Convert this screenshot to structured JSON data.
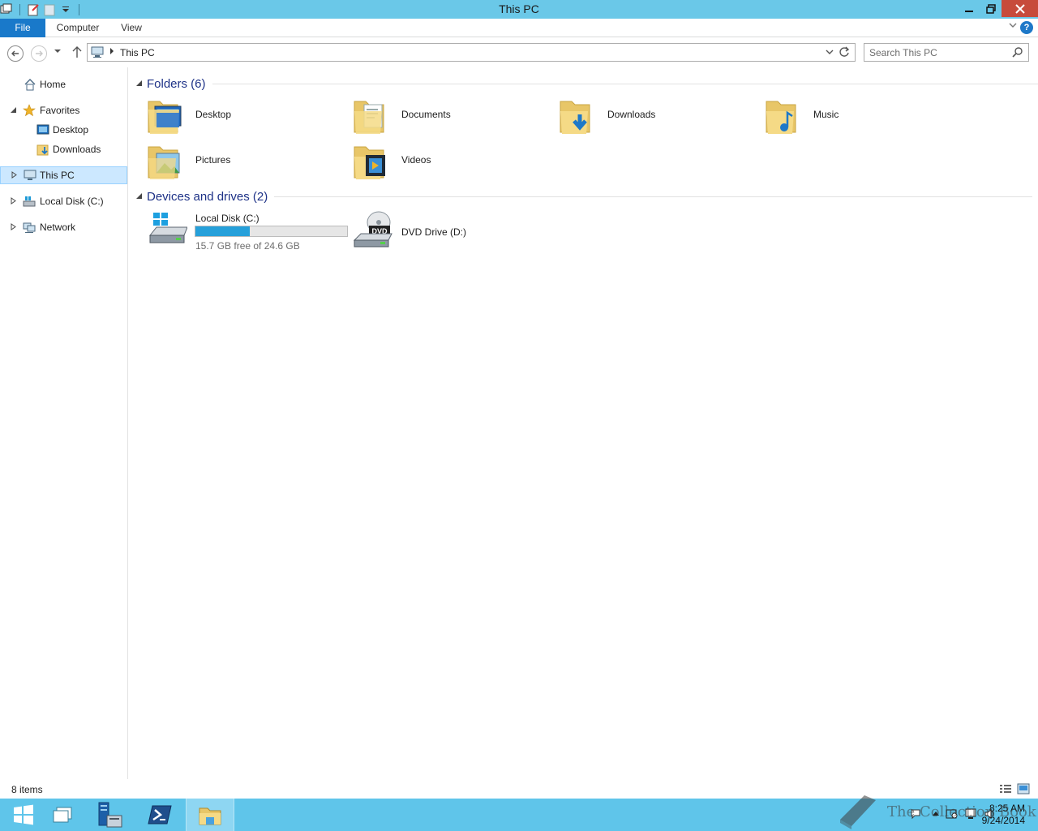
{
  "window": {
    "title": "This PC",
    "controls": {
      "minimize": "−",
      "restore": "❐",
      "close": "✕"
    }
  },
  "ribbon": {
    "tabs": [
      {
        "label": "File",
        "active": true
      },
      {
        "label": "Computer"
      },
      {
        "label": "View"
      }
    ],
    "help_label": "?"
  },
  "address_bar": {
    "breadcrumb": "This PC",
    "icon": "pc-icon"
  },
  "search": {
    "placeholder": "Search This PC"
  },
  "nav_pane": {
    "items": [
      {
        "label": "Home",
        "icon": "home-icon"
      },
      {
        "label": "Favorites",
        "icon": "star-icon",
        "expanded": true
      },
      {
        "label": "Desktop",
        "icon": "desktop-icon"
      },
      {
        "label": "Downloads",
        "icon": "downloads-icon"
      },
      {
        "label": "This PC",
        "icon": "pc-icon",
        "selected": true
      },
      {
        "label": "Local Disk (C:)",
        "icon": "disk-icon"
      },
      {
        "label": "Network",
        "icon": "network-icon"
      }
    ]
  },
  "folders_group": {
    "title": "Folders (6)",
    "items": [
      {
        "label": "Desktop",
        "icon": "desktop-folder-icon"
      },
      {
        "label": "Documents",
        "icon": "documents-folder-icon"
      },
      {
        "label": "Downloads",
        "icon": "downloads-folder-icon"
      },
      {
        "label": "Music",
        "icon": "music-folder-icon"
      },
      {
        "label": "Pictures",
        "icon": "pictures-folder-icon"
      },
      {
        "label": "Videos",
        "icon": "videos-folder-icon"
      }
    ]
  },
  "drives_group": {
    "title": "Devices and drives (2)",
    "items": [
      {
        "label": "Local Disk (C:)",
        "icon": "local-disk-icon",
        "free_text": "15.7 GB free of 24.6 GB",
        "used_fraction": 0.36
      },
      {
        "label": "DVD Drive (D:)",
        "icon": "dvd-drive-icon",
        "badge": "DVD"
      }
    ]
  },
  "status_bar": {
    "item_count": "8 items"
  },
  "taskbar": {
    "buttons": [
      {
        "name": "start",
        "icon": "windows-logo-icon"
      },
      {
        "name": "task-view",
        "icon": "windows-stack-icon"
      },
      {
        "name": "server-manager",
        "icon": "server-manager-icon"
      },
      {
        "name": "powershell",
        "icon": "powershell-icon"
      },
      {
        "name": "file-explorer",
        "icon": "file-explorer-icon",
        "active": true
      }
    ],
    "clock": {
      "time": "8:25 AM",
      "date": "9/24/2014"
    }
  },
  "watermark": {
    "text": "The Collection Book"
  },
  "colors": {
    "title_bar": "#6ac8e8",
    "file_tab": "#1979ca",
    "taskbar": "#5fc5ea",
    "selection": "#cce8ff",
    "group_title": "#1e3287",
    "drive_bar": "#26a0da"
  }
}
